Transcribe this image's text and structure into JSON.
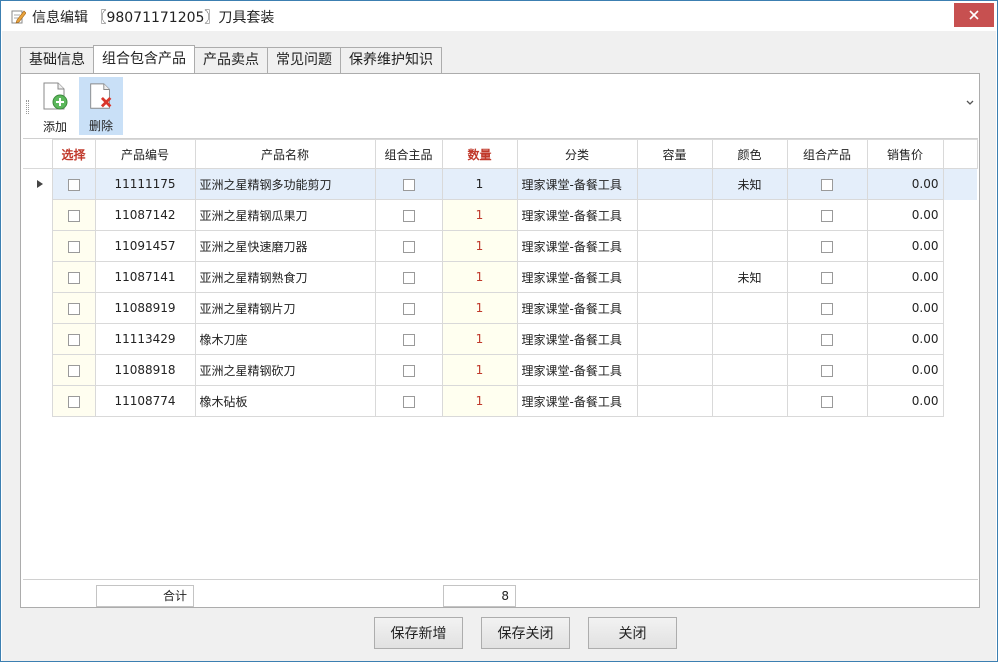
{
  "window": {
    "title": "信息编辑 〖98071171205〗刀具套装"
  },
  "tabs": [
    {
      "label": "基础信息",
      "active": false
    },
    {
      "label": "组合包含产品",
      "active": true
    },
    {
      "label": "产品卖点",
      "active": false
    },
    {
      "label": "常见问题",
      "active": false
    },
    {
      "label": "保养维护知识",
      "active": false
    }
  ],
  "toolbar": {
    "add_label": "添加",
    "delete_label": "删除"
  },
  "table": {
    "columns": [
      "选择",
      "产品编号",
      "产品名称",
      "组合主品",
      "数量",
      "分类",
      "容量",
      "颜色",
      "组合产品",
      "销售价"
    ],
    "rows": [
      {
        "code": "11111175",
        "name": "亚洲之星精钢多功能剪刀",
        "qty": "1",
        "category": "理家课堂-备餐工具",
        "capacity": "",
        "color": "未知",
        "price": "0.00"
      },
      {
        "code": "11087142",
        "name": "亚洲之星精钢瓜果刀",
        "qty": "1",
        "category": "理家课堂-备餐工具",
        "capacity": "",
        "color": "",
        "price": "0.00"
      },
      {
        "code": "11091457",
        "name": "亚洲之星快速磨刀器",
        "qty": "1",
        "category": "理家课堂-备餐工具",
        "capacity": "",
        "color": "",
        "price": "0.00"
      },
      {
        "code": "11087141",
        "name": "亚洲之星精钢熟食刀",
        "qty": "1",
        "category": "理家课堂-备餐工具",
        "capacity": "",
        "color": "未知",
        "price": "0.00"
      },
      {
        "code": "11088919",
        "name": "亚洲之星精钢片刀",
        "qty": "1",
        "category": "理家课堂-备餐工具",
        "capacity": "",
        "color": "",
        "price": "0.00"
      },
      {
        "code": "11113429",
        "name": "橡木刀座",
        "qty": "1",
        "category": "理家课堂-备餐工具",
        "capacity": "",
        "color": "",
        "price": "0.00"
      },
      {
        "code": "11088918",
        "name": "亚洲之星精钢砍刀",
        "qty": "1",
        "category": "理家课堂-备餐工具",
        "capacity": "",
        "color": "",
        "price": "0.00"
      },
      {
        "code": "11108774",
        "name": "橡木砧板",
        "qty": "1",
        "category": "理家课堂-备餐工具",
        "capacity": "",
        "color": "",
        "price": "0.00"
      }
    ]
  },
  "summary": {
    "total_label": "合计",
    "qty_total": "8"
  },
  "buttons": {
    "save_new": "保存新增",
    "save_close": "保存关闭",
    "close": "关闭"
  },
  "colors": {
    "accent_header": "#c0392b",
    "close_button": "#c75050",
    "selected_row": "#e4eefa"
  }
}
